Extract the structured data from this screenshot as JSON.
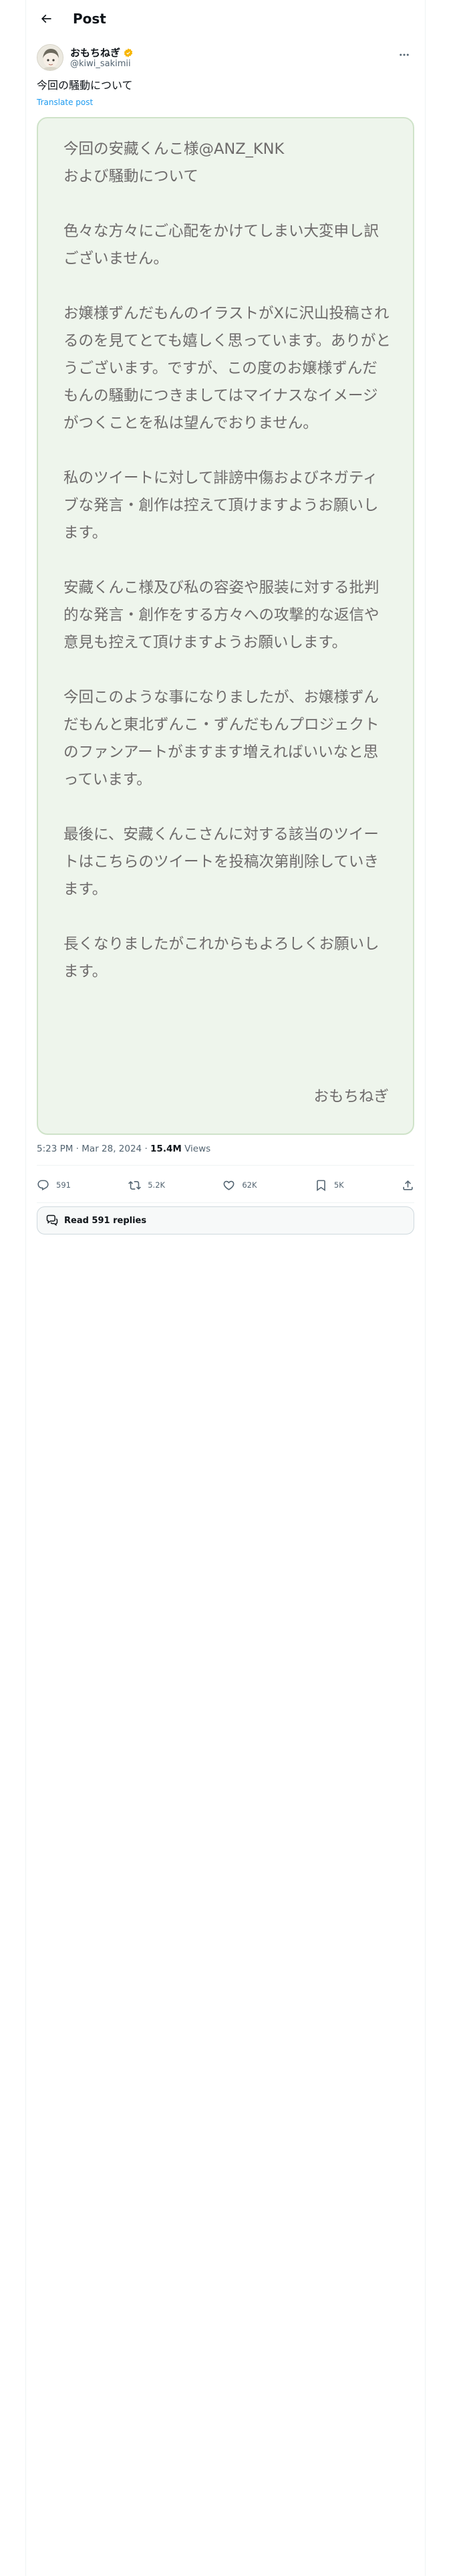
{
  "header": {
    "title": "Post"
  },
  "author": {
    "display_name": "おもちねぎ",
    "handle": "@kiwi_sakimii"
  },
  "post": {
    "text": "今回の騒動について",
    "translate_label": "Translate post",
    "image_text": "今回の安藏くんこ様@ANZ_KNK\nおよび騒動について\n\n色々な方々にご心配をかけてしまい大変申し訳ございません。\n\nお嬢様ずんだもんのイラストがXに沢山投稿されるのを見てとても嬉しく思っています。ありがとうございます。ですが、この度のお嬢様ずんだもんの騒動につきましてはマイナスなイメージがつくことを私は望んでおりません。\n\n私のツイートに対して誹謗中傷およびネガティブな発言・創作は控えて頂けますようお願いします。\n\n安藏くんこ様及び私の容姿や服装に対する批判的な発言・創作をする方々への攻撃的な返信や意見も控えて頂けますようお願いします。\n\n今回このような事になりましたが、お嬢様ずんだもんと東北ずんこ・ずんだもんプロジェクトのファンアートがますます増えればいいなと思っています。\n\n最後に、安藏くんこさんに対する該当のツイートはこちらのツイートを投稿次第削除していきます。\n\n長くなりましたがこれからもよろしくお願いします。",
    "image_signature": "おもちねぎ"
  },
  "meta": {
    "time_date": "5:23 PM · Mar 28, 2024 · ",
    "views_count": "15.4M",
    "views_label": " Views"
  },
  "actions": {
    "reply_count": "591",
    "repost_count": "5.2K",
    "like_count": "62K",
    "bookmark_count": "5K"
  },
  "replies_button": {
    "label": "Read 591 replies"
  },
  "colors": {
    "accent": "#1d9bf0",
    "verified": "#f7b500",
    "card_bg": "#eef5ec"
  }
}
